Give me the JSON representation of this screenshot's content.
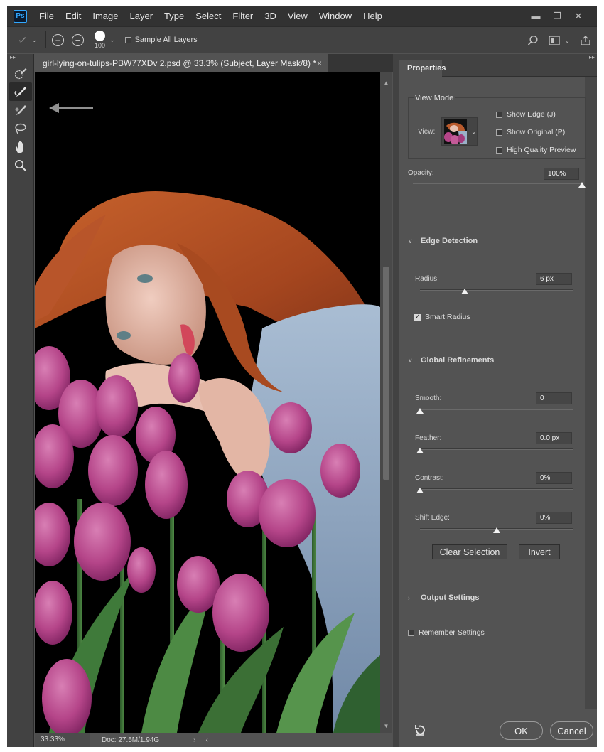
{
  "app": {
    "logo": "Ps"
  },
  "menu": [
    "File",
    "Edit",
    "Image",
    "Layer",
    "Type",
    "Select",
    "Filter",
    "3D",
    "View",
    "Window",
    "Help"
  ],
  "window_controls": {
    "minimize": "▬",
    "restore": "❐",
    "close": "✕"
  },
  "options": {
    "brush_size": "100",
    "sample_all_layers": {
      "label": "Sample All Layers",
      "checked": false
    }
  },
  "tools": [
    "quick-selection-tool",
    "refine-edge-brush-tool",
    "brush-tool",
    "lasso-tool",
    "hand-tool",
    "zoom-tool"
  ],
  "document": {
    "tab_title": "girl-lying-on-tulips-PBW77XDv 2.psd @ 33.3% (Subject, Layer Mask/8) *",
    "close": "×"
  },
  "status": {
    "zoom": "33.33%",
    "doc_size": "Doc: 27.5M/1.94G",
    "nav_arrow": "›",
    "nav_arrow2": "‹"
  },
  "properties": {
    "tab": "Properties",
    "view_mode": {
      "title": "View Mode",
      "view_label": "View:",
      "show_edge": {
        "label": "Show Edge (J)",
        "checked": false
      },
      "show_original": {
        "label": "Show Original (P)",
        "checked": false
      },
      "high_quality": {
        "label": "High Quality Preview",
        "checked": false
      }
    },
    "opacity": {
      "label": "Opacity:",
      "value": "100%",
      "level": 1.0
    },
    "edge_detection": {
      "title": "Edge Detection",
      "radius": {
        "label": "Radius:",
        "value": "6 px",
        "level": 0.29
      },
      "smart_radius": {
        "label": "Smart Radius",
        "checked": true
      }
    },
    "global_refinements": {
      "title": "Global Refinements",
      "smooth": {
        "label": "Smooth:",
        "value": "0",
        "level": 0
      },
      "feather": {
        "label": "Feather:",
        "value": "0.0 px",
        "level": 0
      },
      "contrast": {
        "label": "Contrast:",
        "value": "0%",
        "level": 0
      },
      "shift_edge": {
        "label": "Shift Edge:",
        "value": "0%",
        "level": 0.5
      }
    },
    "buttons": {
      "clear_selection": "Clear Selection",
      "invert": "Invert"
    },
    "output_settings": {
      "title": "Output Settings"
    },
    "remember_settings": {
      "label": "Remember Settings",
      "checked": false
    },
    "ok": "OK",
    "cancel": "Cancel"
  },
  "colors": {
    "accent": "#31a8ff",
    "panel": "#535353",
    "dark": "#323232"
  }
}
